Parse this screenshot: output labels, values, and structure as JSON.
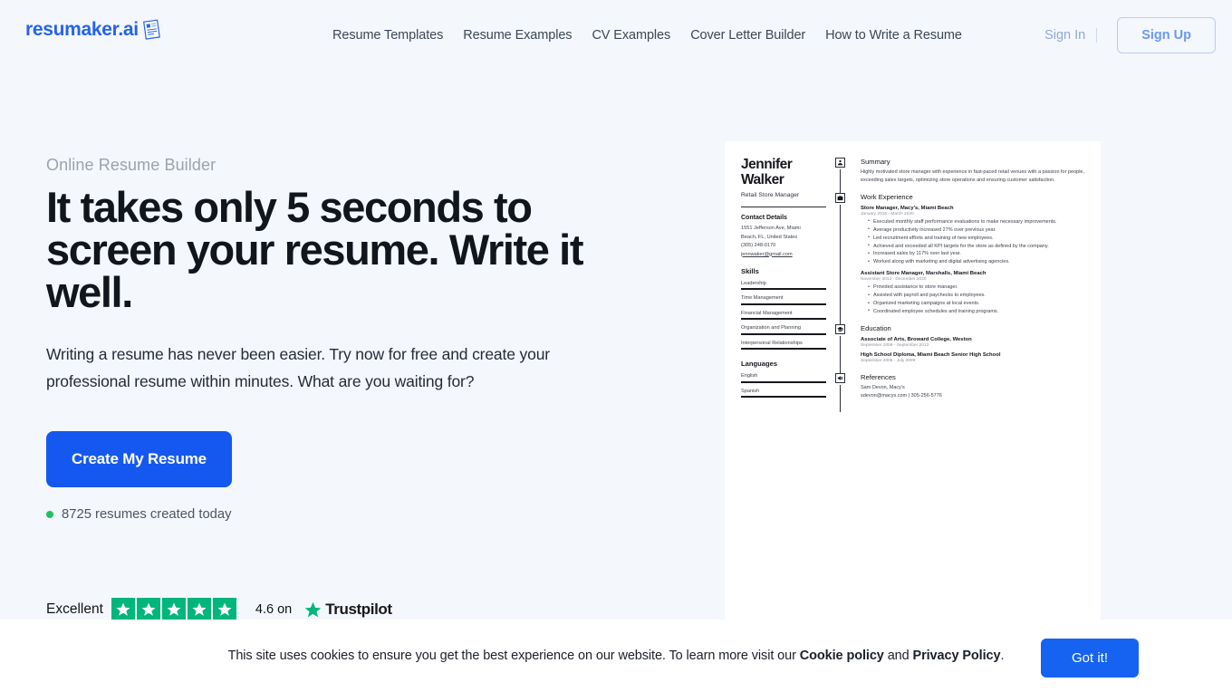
{
  "brand": {
    "logo_text": "resumaker.ai",
    "accent_blue": "#2563eb",
    "cta_blue": "#1558f0",
    "trust_green": "#00b67a"
  },
  "header": {
    "nav": [
      {
        "label": "Resume Templates"
      },
      {
        "label": "Resume Examples"
      },
      {
        "label": "CV Examples"
      },
      {
        "label": "Cover Letter Builder"
      },
      {
        "label": "How to Write a Resume"
      }
    ],
    "sign_in": "Sign In",
    "sign_up": "Sign Up"
  },
  "hero": {
    "eyebrow": "Online Resume Builder",
    "headline": "It takes only 5 seconds to screen your resume. Write it well.",
    "subcopy": "Writing a resume has never been easier. Try now for free and create your professional resume within minutes. What are you waiting for?",
    "cta_label": "Create My Resume",
    "counter": "8725 resumes created today"
  },
  "trustpilot": {
    "word": "Excellent",
    "stars": 5,
    "score_text": "4.6 on",
    "brand": "Trustpilot"
  },
  "resume": {
    "name": "Jennifer Walker",
    "name_line1": "Jennifer",
    "name_line2": "Walker",
    "role": "Retail Store Manager",
    "contact_heading": "Contact Details",
    "address_line1": "1551 Jefferson Ave, Miami",
    "address_line2": "Beach, FL, United States",
    "phone": "(305) 248-0170",
    "email": "jennwaker@gmail.com",
    "skills_heading": "Skills",
    "skills": [
      {
        "label": "Leadership"
      },
      {
        "label": "Time Management"
      },
      {
        "label": "Financial Management"
      },
      {
        "label": "Organization and Planning"
      },
      {
        "label": "Interpersonal Relationships"
      }
    ],
    "languages_heading": "Languages",
    "languages": [
      {
        "label": "English"
      },
      {
        "label": "Spanish"
      }
    ],
    "summary_heading": "Summary",
    "summary_text": "Highly motivated store manager with experience in fast-paced retail venues with a passion for people, exceeding sales targets, optimizing store operations and ensuring customer satisfaction.",
    "work_heading": "Work Experience",
    "jobs": [
      {
        "title": "Store Manager, Macy's, Miami Beach",
        "dates": "January 2016 - March 2020",
        "bullets": [
          "Executed monthly staff performance evaluations to make necessary improvements.",
          "Average productivity increased 27% over previous year.",
          "Led recruitment efforts and training of new employees.",
          "Achieved and exceeded all KPI targets for the store as defined by the company.",
          "Increased sales by 117% over last year.",
          "Worked along with marketing and digital advertising agencies."
        ]
      },
      {
        "title": "Assistant Store Manager, Marshalls, Miami Beach",
        "dates": "November 2013 - December 2020",
        "bullets": [
          "Provided assistance to store manager.",
          "Assisted with payroll and paychecks to employees.",
          "Organized marketing campaigns at local events.",
          "Coordinated employee schedules and training programs."
        ]
      }
    ],
    "education_heading": "Education",
    "education": [
      {
        "title": "Associate of Arts, Broward College, Weston",
        "dates": "September 2009 - September 2013"
      },
      {
        "title": "High School Diploma, Miami Beach Senior High School",
        "dates": "September 2005 - July 2009"
      }
    ],
    "references_heading": "References",
    "reference_name": "Sam Devon, Macy's",
    "reference_contact": "sdevon@macys.com | 305-256-5776"
  },
  "cookie": {
    "text_before": "This site uses cookies to ensure you get the best experience on our website. To learn more visit our ",
    "link1": "Cookie policy",
    "text_mid": " and ",
    "link2": "Privacy Policy",
    "text_after": ".",
    "button": "Got it!"
  }
}
